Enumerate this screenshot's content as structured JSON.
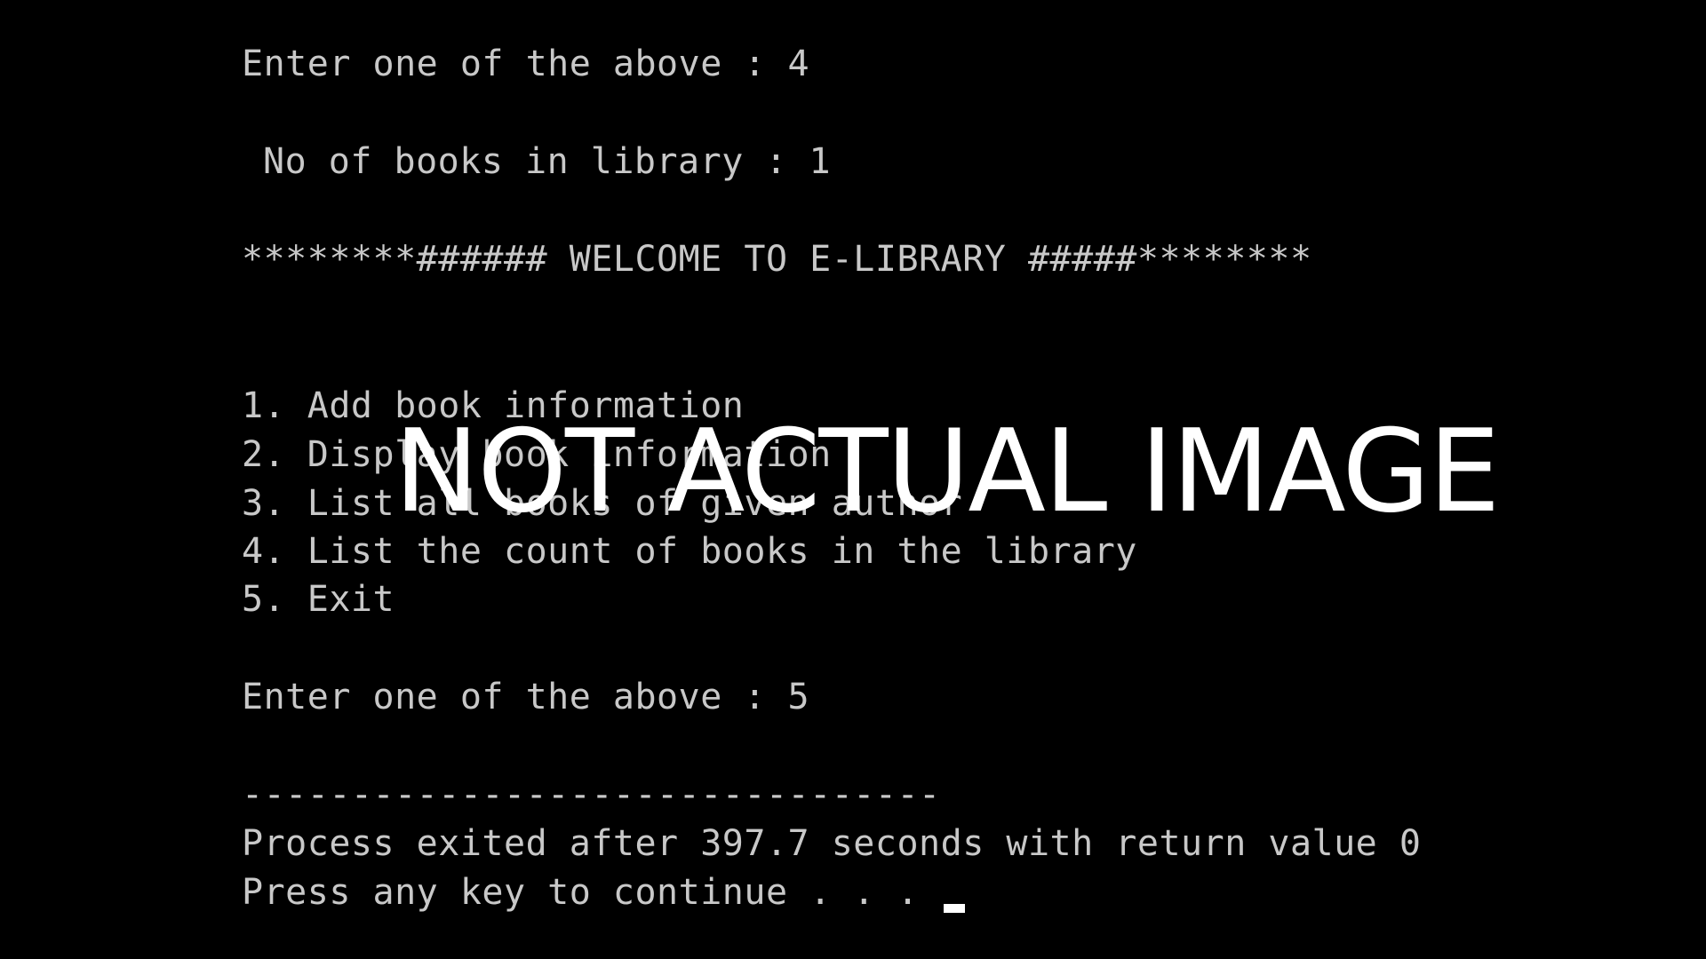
{
  "terminal": {
    "lines": {
      "prompt1": "Enter one of the above : 4",
      "book_count": "No of books in library : 1",
      "banner": "********###### WELCOME TO E-LIBRARY #####********",
      "menu": [
        "1. Add book information",
        "2. Display book information",
        "3. List all books of given author",
        "4. List the count of books in the library",
        "5. Exit"
      ],
      "prompt2": "Enter one of the above : 5",
      "separator": "--------------------------------",
      "exit_status": "Process exited after 397.7 seconds with return value 0",
      "continue_prompt": "Press any key to continue . . . "
    }
  },
  "watermark": {
    "text": "NOT ACTUAL IMAGE"
  },
  "colors": {
    "background": "#000000",
    "text": "#c8c8c8",
    "watermark": "#ffffff"
  }
}
